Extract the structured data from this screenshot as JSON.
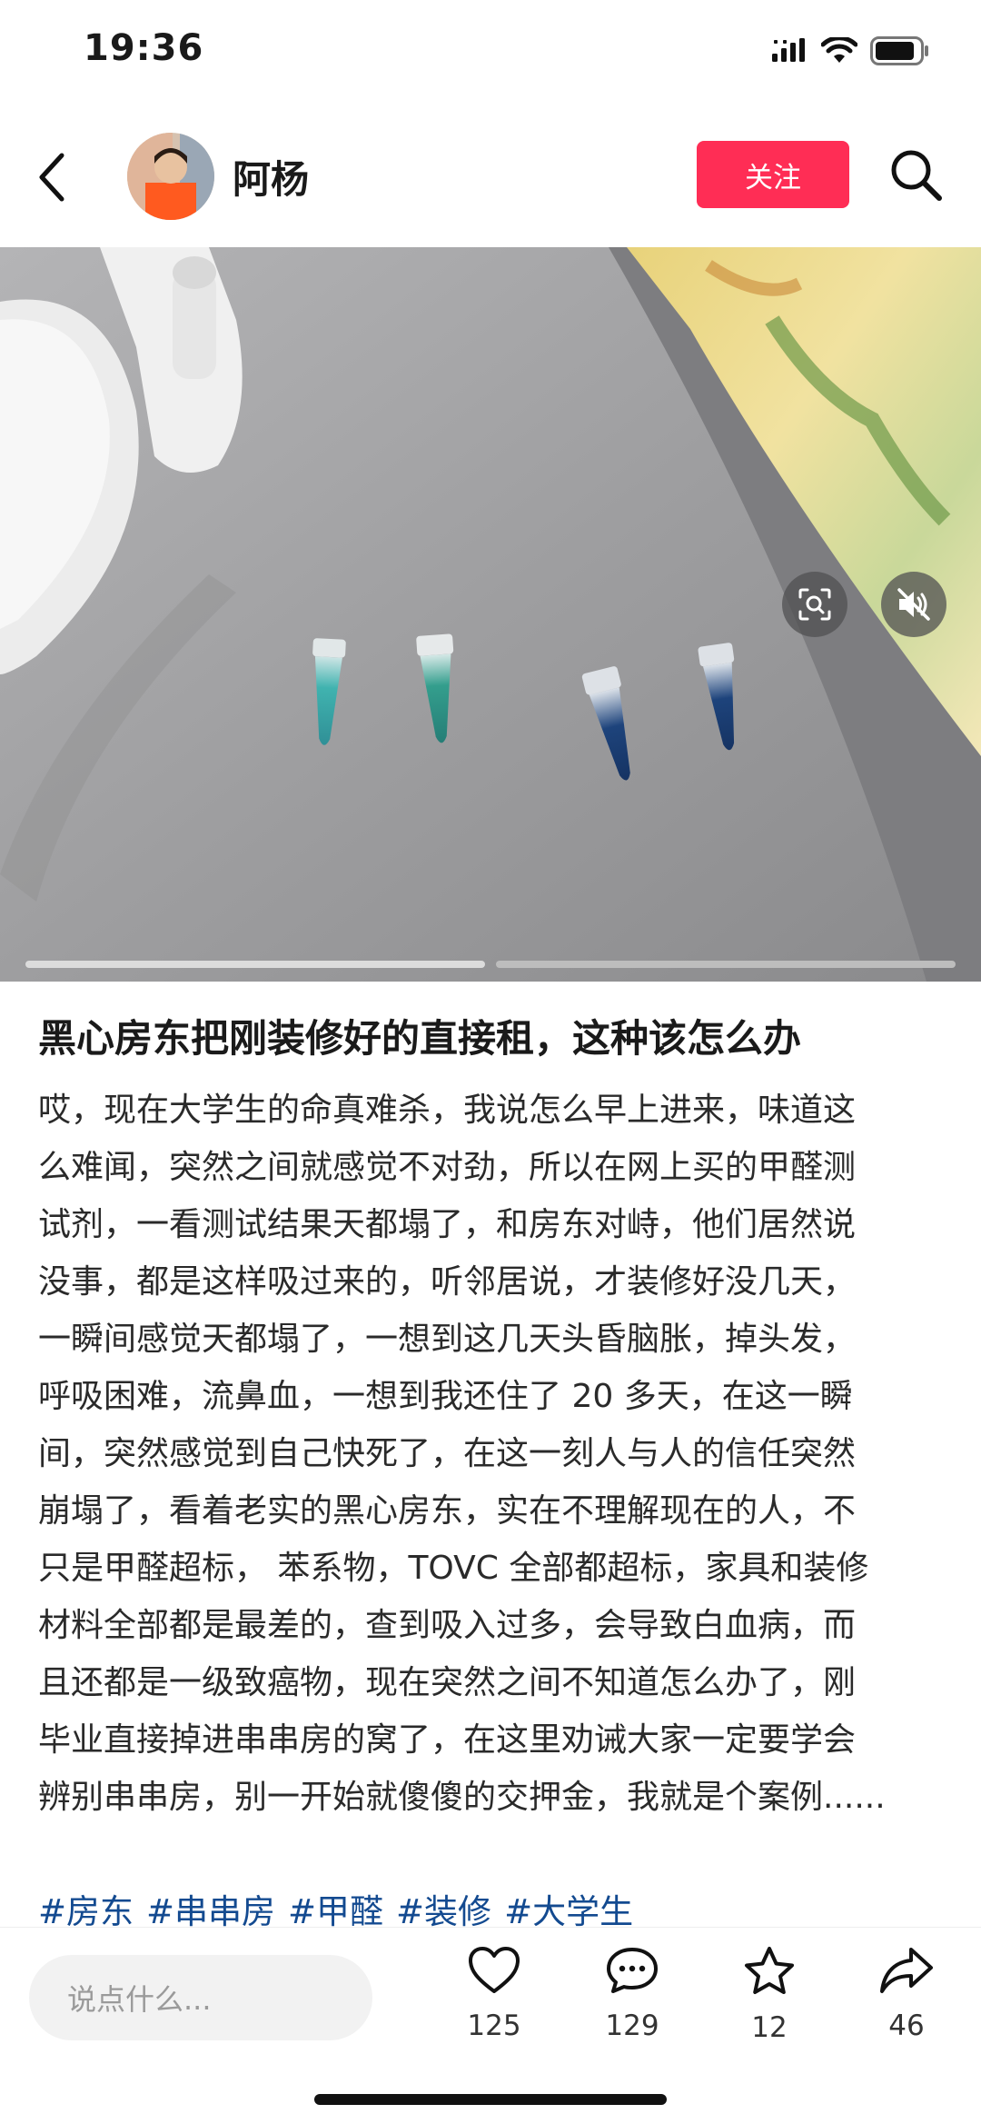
{
  "status_bar": {
    "time": "19:36",
    "icons": [
      "signal-icon",
      "wifi-icon",
      "battery-icon"
    ]
  },
  "header": {
    "back_icon": "chevron-left-icon",
    "username": "阿杨",
    "follow_label": "关注",
    "search_icon": "search-icon"
  },
  "media": {
    "controls": [
      "scan-icon",
      "mute-icon"
    ],
    "image_count": 2,
    "current_index": 1
  },
  "post": {
    "title": "黑心房东把刚装修好的直接租，这种该怎么办",
    "body_lines": [
      "哎，现在大学生的命真难杀，我说怎么早上进来，味道这",
      "么难闻，突然之间就感觉不对劲，所以在网上买的甲醛测",
      "试剂，一看测试结果天都塌了，和房东对峙，他们居然说",
      "没事，都是这样吸过来的，听邻居说，才装修好没几天，",
      "一瞬间感觉天都塌了，一想到这几天头昏脑胀，掉头发，",
      "呼吸困难，流鼻血，一想到我还住了 20 多天，在这一瞬",
      "间，突然感觉到自己快死了，在这一刻人与人的信任突然",
      "崩塌了，看着老实的黑心房东，实在不理解现在的人，不",
      "只是甲醛超标， 苯系物，TOVC 全部都超标，家具和装修",
      "材料全部都是最差的，查到吸入过多，会导致白血病，而",
      "且还都是一级致癌物，现在突然之间不知道怎么办了，刚",
      "毕业直接掉进串串房的窝了，在这里劝诫大家一定要学会",
      "辨别串串房，别一开始就傻傻的交押金，我就是个案例......"
    ],
    "tags": [
      "#房东",
      "#串串房",
      "#甲醛",
      "#装修",
      "#大学生"
    ]
  },
  "bottom_bar": {
    "comment_placeholder": "说点什么...",
    "like_count": "125",
    "comment_count": "129",
    "star_count": "12",
    "share_count": "46"
  },
  "colors": {
    "accent": "#ff2d55",
    "tag": "#134a90"
  }
}
